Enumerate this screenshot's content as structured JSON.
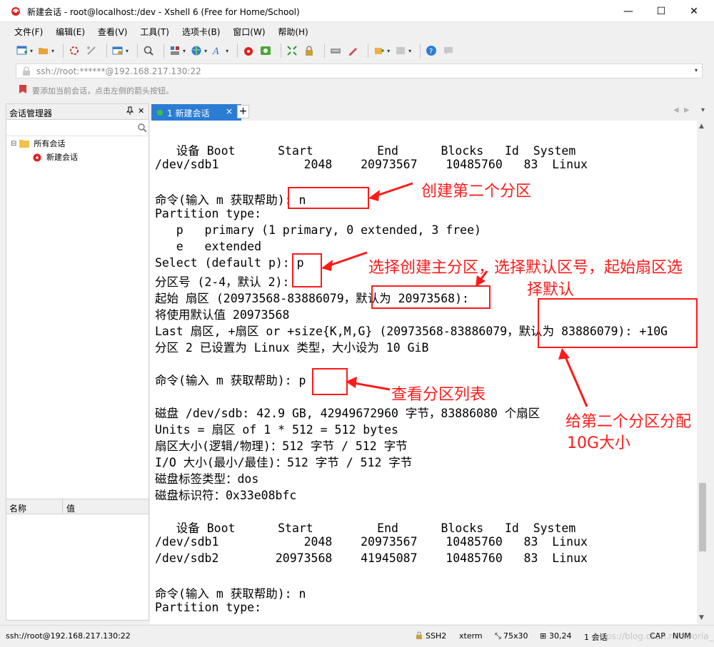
{
  "window": {
    "title": "新建会话 - root@localhost:/dev - Xshell 6 (Free for Home/School)",
    "minimize": "—",
    "maximize": "☐",
    "close": "✕"
  },
  "menu": [
    "文件(F)",
    "编辑(E)",
    "查看(V)",
    "工具(T)",
    "选项卡(B)",
    "窗口(W)",
    "帮助(H)"
  ],
  "address": {
    "value": "ssh://root:******@192.168.217.130:22"
  },
  "hint": "要添加当前会话，点击左侧的箭头按钮。",
  "session_manager": {
    "title": "会话管理器",
    "pin": "ᵖ",
    "close": "✕",
    "tree": {
      "root_label": "所有会话",
      "child_label": "新建会话",
      "expander": "⊟"
    },
    "properties": {
      "col_name": "名称",
      "col_value": "值"
    }
  },
  "tabs": {
    "active_label": "1 新建会话",
    "close": "×",
    "add": "+",
    "nav_left": "◀",
    "nav_right": "▶",
    "nav_more": "▾"
  },
  "terminal": {
    "lines": [
      "   设备 Boot      Start         End      Blocks   Id  System",
      "/dev/sdb1            2048    20973567    10485760   83  Linux",
      "",
      "命令(输入 m 获取帮助): n",
      "Partition type:",
      "   p   primary (1 primary, 0 extended, 3 free)",
      "   e   extended",
      "Select (default p): p",
      "分区号 (2-4，默认 2):",
      "起始 扇区 (20973568-83886079，默认为 20973568):",
      "将使用默认值 20973568",
      "Last 扇区, +扇区 or +size{K,M,G} (20973568-83886079，默认为 83886079): +10G",
      "分区 2 已设置为 Linux 类型，大小设为 10 GiB",
      "",
      "命令(输入 m 获取帮助): p",
      "",
      "磁盘 /dev/sdb: 42.9 GB, 42949672960 字节，83886080 个扇区",
      "Units = 扇区 of 1 * 512 = 512 bytes",
      "扇区大小(逻辑/物理)：512 字节 / 512 字节",
      "I/O 大小(最小/最佳)：512 字节 / 512 字节",
      "磁盘标签类型：dos",
      "磁盘标识符：0x33e08bfc",
      "",
      "   设备 Boot      Start         End      Blocks   Id  System",
      "/dev/sdb1            2048    20973567    10485760   83  Linux",
      "/dev/sdb2        20973568    41945087    10485760   83  Linux",
      "",
      "命令(输入 m 获取帮助): n",
      "Partition type:"
    ]
  },
  "annotations": {
    "create_second": "创建第二个分区",
    "select_line1": "选择创建主分区，选择默认区号，起始扇区选",
    "select_line2": "择默认",
    "view_list": "查看分区列表",
    "allocate_line1": "给第二个分区分配",
    "allocate_line2": "10G大小",
    "color": "#ff1a1a"
  },
  "statusbar": {
    "connection": "ssh://root@192.168.217.130:22",
    "protocol": "SSH2",
    "term": "xterm",
    "size": "75x30",
    "cursor": "30,24",
    "sessions": "1 会话",
    "caps": "CAP",
    "num": "NUM",
    "watermark": "https://blog.csdn.net/Doria_"
  },
  "colors": {
    "tab_active": "#2b7cd3",
    "tab_dot": "#3cc13c",
    "annotation_red": "#ff1a1a"
  }
}
